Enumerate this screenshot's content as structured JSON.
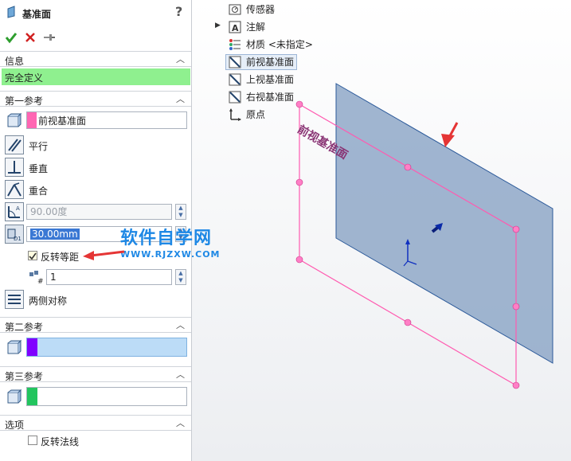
{
  "property_manager": {
    "title": "基准面",
    "help": "?",
    "info": {
      "header": "信息",
      "status": "完全定义"
    },
    "first_ref": {
      "header": "第一参考",
      "selection": "前视基准面",
      "selection_color": "#ff66b3",
      "options": [
        "平行",
        "垂直",
        "重合"
      ],
      "angle_value": "90.00度",
      "distance_value": "30.00mm",
      "flip_offset_label": "反转等距",
      "flip_offset_checked": true,
      "count_value": "1",
      "symmetric_label": "两侧对称"
    },
    "second_ref": {
      "header": "第二参考",
      "selection_color": "#8000ff"
    },
    "third_ref": {
      "header": "第三参考",
      "selection_color": "#22c55e"
    },
    "options": {
      "header": "选项",
      "flip_normal_label": "反转法线",
      "flip_normal_checked": false
    }
  },
  "watermark": {
    "title": "软件自学网",
    "url": "WWW.RJZXW.COM"
  },
  "feature_tree": [
    {
      "label": "传感器",
      "icon": "sensor-icon"
    },
    {
      "label": "注解",
      "icon": "annotation-icon",
      "expandable": true
    },
    {
      "label": "材质 <未指定>",
      "icon": "material-icon"
    },
    {
      "label": "前视基准面",
      "icon": "plane-icon",
      "selected": true
    },
    {
      "label": "上视基准面",
      "icon": "plane-icon"
    },
    {
      "label": "右视基准面",
      "icon": "plane-icon"
    },
    {
      "label": "原点",
      "icon": "origin-icon"
    }
  ],
  "viewport": {
    "plane_label": "前视基准面"
  }
}
